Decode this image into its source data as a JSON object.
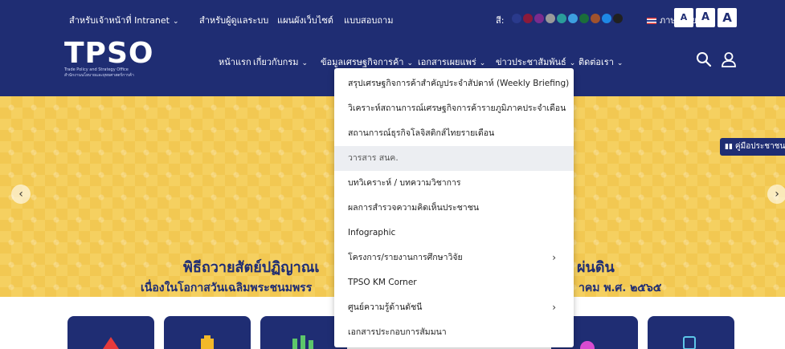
{
  "topbar": {
    "links": [
      "สำหรับเจ้าหน้าที่ Intranet",
      "สำหรับผู้ดูแลระบบ",
      "แผนผังเว็บไซต์",
      "แบบสอบถาม"
    ],
    "color_label": "สี:",
    "swatch_colors": [
      "#2a3a8c",
      "#8b1a3a",
      "#7a2b8e",
      "#9a9a9a",
      "#2a9d9a",
      "#3d9fe0",
      "#1a6e3a",
      "#a0522d",
      "#1e88e5",
      "#202020"
    ],
    "language": "ภาษาไทย",
    "font_sizes": [
      "A",
      "A",
      "A"
    ]
  },
  "logo": {
    "text": "TPSO",
    "tagline": "Trade Policy and Strategy Office",
    "tagline_th": "สำนักงานนโยบายและยุทธศาสตร์การค้า"
  },
  "nav": {
    "items": [
      "หน้าแรก",
      "เกี่ยวกับกรม",
      "ข้อมูลเศรษฐกิจการค้า",
      "เอกสารเผยแพร่",
      "ข่าวประชาสัมพันธ์",
      "ติดต่อเรา"
    ]
  },
  "hero": {
    "title_a": "พิธีถวายสัตย์ปฏิญาณเ",
    "title_b": "ผ่นดิน",
    "sub_a": "เนื่องในโอกาสวันเฉลิมพระชนมพรร",
    "sub_b": "าคม พ.ศ. ๒๕๖๕"
  },
  "manual_tab": "คู่มือประชาชน",
  "dropdown": {
    "items": [
      {
        "label": "สรุปเศรษฐกิจการค้าสำคัญประจำสัปดาห์ (Weekly Briefing)",
        "submenu": false
      },
      {
        "label": "วิเคราะห์สถานการณ์เศรษฐกิจการค้ารายภูมิภาคประจำเดือน",
        "submenu": false
      },
      {
        "label": "สถานการณ์ธุรกิจโลจิสติกส์ไทยรายเดือน",
        "submenu": false
      },
      {
        "label": "วารสาร สนค.",
        "submenu": false,
        "active": true
      },
      {
        "label": "บทวิเคราะห์ / บทความวิชาการ",
        "submenu": false
      },
      {
        "label": "ผลการสำรวจความคิดเห็นประชาชน",
        "submenu": false
      },
      {
        "label": "Infographic",
        "submenu": false
      },
      {
        "label": "โครงการ/รายงานการศึกษาวิจัย",
        "submenu": true
      },
      {
        "label": "TPSO KM Corner",
        "submenu": false
      },
      {
        "label": "ศูนย์ความรู้ด้านดัชนี",
        "submenu": true
      },
      {
        "label": "เอกสารประกอบการสัมมนา",
        "submenu": false
      }
    ]
  },
  "colors": {
    "header_bg": "#1f2d73",
    "hero_bg": "#f5d060",
    "active_item_bg": "#eceef2"
  }
}
